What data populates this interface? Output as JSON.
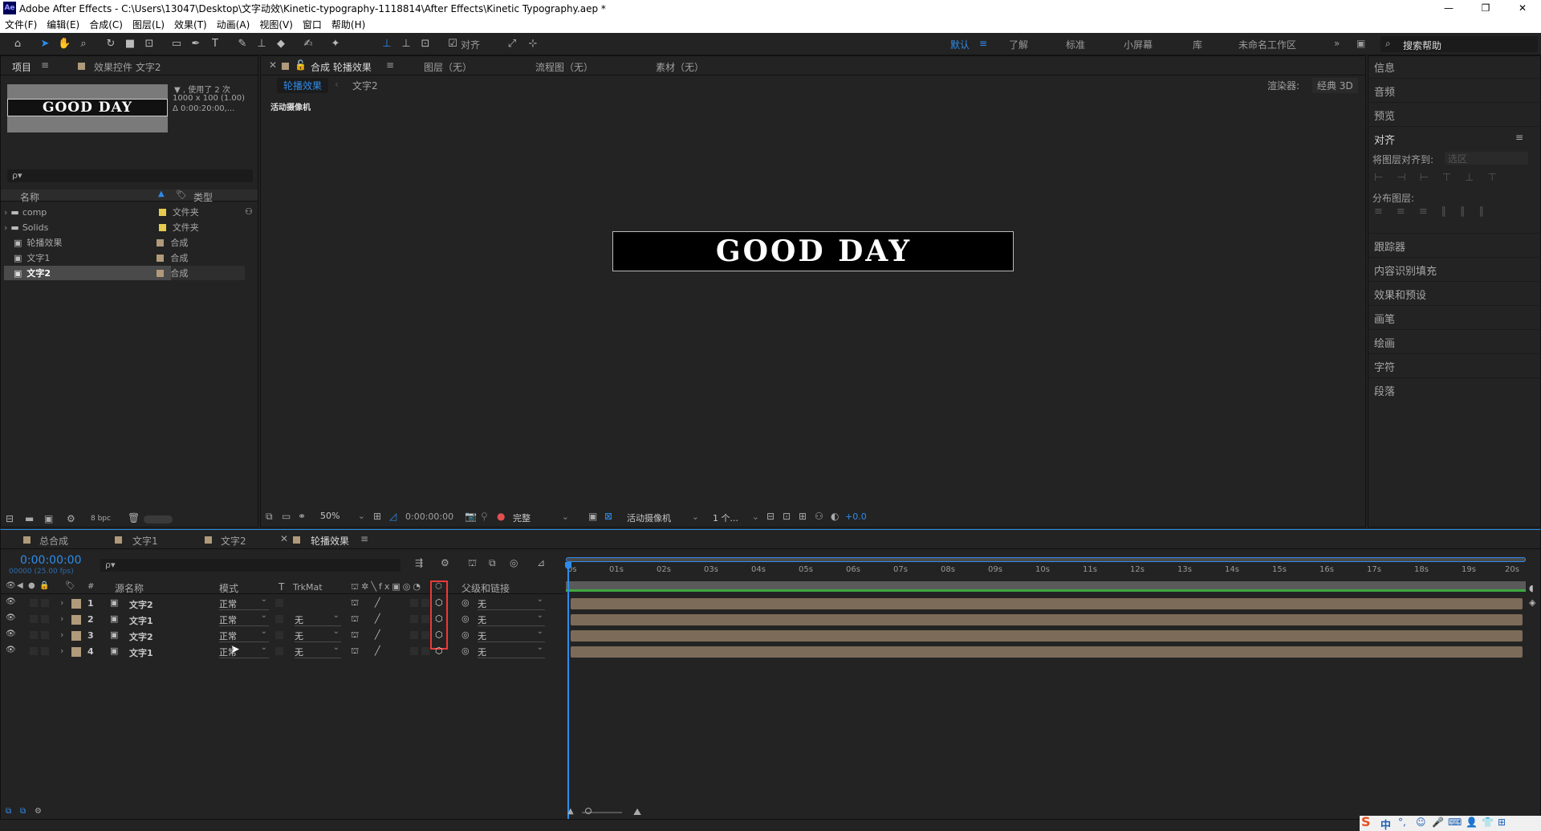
{
  "window": {
    "app_icon": "Ae",
    "title": "Adobe After Effects - C:\\Users\\13047\\Desktop\\文字动效\\Kinetic-typography-1118814\\After Effects\\Kinetic Typography.aep *",
    "minimize": "—",
    "maximize": "❐",
    "close": "✕"
  },
  "menu": [
    "文件(F)",
    "编辑(E)",
    "合成(C)",
    "图层(L)",
    "效果(T)",
    "动画(A)",
    "视图(V)",
    "窗口",
    "帮助(H)"
  ],
  "toolbar": {
    "snap_label": "对齐",
    "workspaces": [
      "默认",
      "了解",
      "标准",
      "小屏幕",
      "库",
      "未命名工作区"
    ],
    "active_workspace": "默认",
    "search_help": "搜索帮助"
  },
  "project_panel": {
    "tab_project": "项目",
    "tab_effects": "效果控件 文字2",
    "thumb_text": "GOOD DAY",
    "info_used": "▼ , 使用了 2 次",
    "info_size": "1000 x 100 (1.00)",
    "info_duration": "Δ 0:00:20:00,...",
    "search_placeholder": "ρ▾",
    "col_name": "名称",
    "col_type": "类型",
    "items": [
      {
        "name": "comp",
        "type": "文件夹",
        "kind": "folder",
        "color": "#e6cc4f"
      },
      {
        "name": "Solids",
        "type": "文件夹",
        "kind": "folder",
        "color": "#e6cc4f"
      },
      {
        "name": "轮播效果",
        "type": "合成",
        "kind": "comp",
        "color": "#b09a7a"
      },
      {
        "name": "文字1",
        "type": "合成",
        "kind": "comp",
        "color": "#b09a7a"
      },
      {
        "name": "文字2",
        "type": "合成",
        "kind": "comp",
        "color": "#b09a7a"
      }
    ],
    "bpc": "8 bpc"
  },
  "composition_panel": {
    "tab_comp": "合成 轮播效果",
    "tab_layer": "图层（无）",
    "tab_flow": "流程图（无）",
    "tab_footage": "素材（无）",
    "breadcrumb_1": "轮播效果",
    "breadcrumb_2": "文字2",
    "renderer_label": "渲染器:",
    "renderer_value": "经典 3D",
    "camera_label": "活动摄像机",
    "comp_text": "GOOD DAY",
    "zoom": "50%",
    "timecode": "0:00:00:00",
    "quality": "完整",
    "view_camera": "活动摄像机",
    "views": "1 个...",
    "exposure": "+0.0"
  },
  "right_panel": {
    "items": [
      "信息",
      "音频",
      "预览",
      "对齐",
      "跟踪器",
      "内容识别填充",
      "效果和预设",
      "画笔",
      "绘画",
      "字符",
      "段落"
    ],
    "align_to_label": "将图层对齐到:",
    "align_to_value": "选区",
    "distribute_label": "分布图层:"
  },
  "timeline": {
    "tabs": [
      "总合成",
      "文字1",
      "文字2",
      "轮播效果"
    ],
    "active_tab": "轮播效果",
    "timecode": "0:00:00:00",
    "frames": "00000 (25.00 fps)",
    "search_placeholder": "ρ▾",
    "col_source": "源名称",
    "col_mode": "模式",
    "col_t": "T",
    "col_trkmat": "TrkMat",
    "col_parent": "父级和链接",
    "layers": [
      {
        "num": "1",
        "name": "文字2",
        "mode": "正常",
        "trkmat": "",
        "parent": "无"
      },
      {
        "num": "2",
        "name": "文字1",
        "mode": "正常",
        "trkmat": "无",
        "parent": "无"
      },
      {
        "num": "3",
        "name": "文字2",
        "mode": "正常",
        "trkmat": "无",
        "parent": "无"
      },
      {
        "num": "4",
        "name": "文字1",
        "mode": "正常",
        "trkmat": "无",
        "parent": "无"
      }
    ],
    "ruler": [
      "0s",
      "01s",
      "02s",
      "03s",
      "04s",
      "05s",
      "06s",
      "07s",
      "08s",
      "09s",
      "10s",
      "11s",
      "12s",
      "13s",
      "14s",
      "15s",
      "16s",
      "17s",
      "18s",
      "19s",
      "20s"
    ]
  },
  "colors": {
    "accent": "#2d8ceb",
    "highlight_box": "#e83a3a",
    "layer_bar": "#7c6b58",
    "label_tan": "#b09a7a"
  },
  "tray": {
    "ime": "中"
  }
}
